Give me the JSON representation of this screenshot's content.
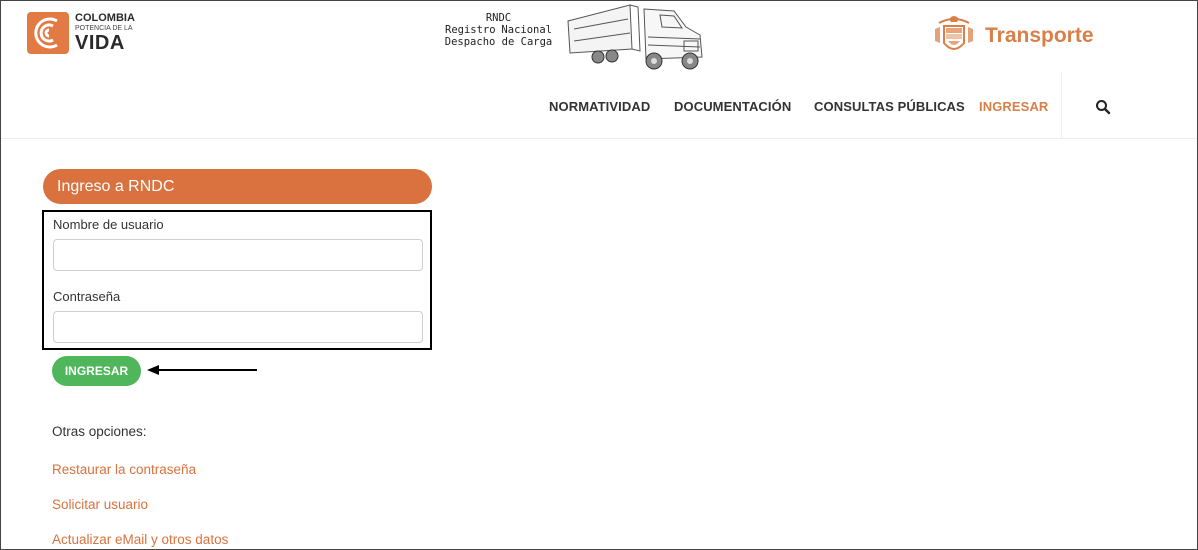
{
  "header": {
    "left_logo": {
      "line1": "COLOMBIA",
      "line2": "POTENCIA DE LA",
      "line3": "VIDA",
      "icon": "colombia-potencia-logo"
    },
    "center": {
      "title": "RNDC",
      "line2_a": "Registro",
      "line2_b": "Nacional",
      "line3": "Despacho de Carga",
      "image": "truck-illustration"
    },
    "right_logo": {
      "label": "Transporte",
      "icon": "colombia-coat-of-arms"
    }
  },
  "nav": {
    "items": [
      {
        "label": "NORMATIVIDAD",
        "active": false
      },
      {
        "label": "DOCUMENTACIÓN",
        "active": false
      },
      {
        "label": "CONSULTAS PÚBLICAS",
        "active": false
      },
      {
        "label": "INGRESAR",
        "active": true
      }
    ],
    "search_icon": "search-icon"
  },
  "login": {
    "title": "Ingreso a RNDC",
    "username_label": "Nombre de usuario",
    "username_value": "",
    "password_label": "Contraseña",
    "password_value": "",
    "submit_label": "INGRESAR"
  },
  "other_options": {
    "title": "Otras opciones:",
    "links": [
      "Restaurar la contraseña",
      "Solicitar usuario",
      "Actualizar eMail y otros datos"
    ]
  },
  "colors": {
    "accent": "#d9723e",
    "submit": "#4fb65b",
    "text": "#333333"
  }
}
